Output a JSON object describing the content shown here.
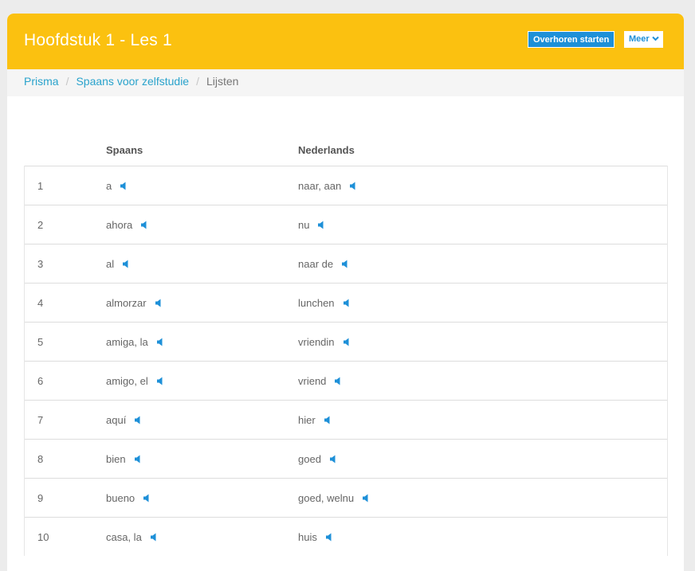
{
  "header": {
    "title": "Hoofdstuk 1 - Les 1",
    "start_button": "Overhoren starten",
    "more_button": "Meer",
    "more_icon": "chevron-down-icon"
  },
  "breadcrumb": {
    "items": [
      "Prisma",
      "Spaans voor zelfstudie",
      "Lijsten"
    ]
  },
  "table": {
    "col_spanish": "Spaans",
    "col_dutch": "Nederlands",
    "audio_icon": "speaker-icon",
    "rows": [
      {
        "n": "1",
        "es": "a",
        "nl": "naar, aan"
      },
      {
        "n": "2",
        "es": "ahora",
        "nl": "nu"
      },
      {
        "n": "3",
        "es": "al",
        "nl": "naar de"
      },
      {
        "n": "4",
        "es": "almorzar",
        "nl": "lunchen"
      },
      {
        "n": "5",
        "es": "amiga, la",
        "nl": "vriendin"
      },
      {
        "n": "6",
        "es": "amigo, el",
        "nl": "vriend"
      },
      {
        "n": "7",
        "es": "aquí",
        "nl": "hier"
      },
      {
        "n": "8",
        "es": "bien",
        "nl": "goed"
      },
      {
        "n": "9",
        "es": "bueno",
        "nl": "goed, welnu"
      },
      {
        "n": "10",
        "es": "casa, la",
        "nl": "huis"
      }
    ]
  },
  "colors": {
    "header": "#fbc110",
    "accent": "#1e90d8",
    "link": "#2aa3cc"
  }
}
